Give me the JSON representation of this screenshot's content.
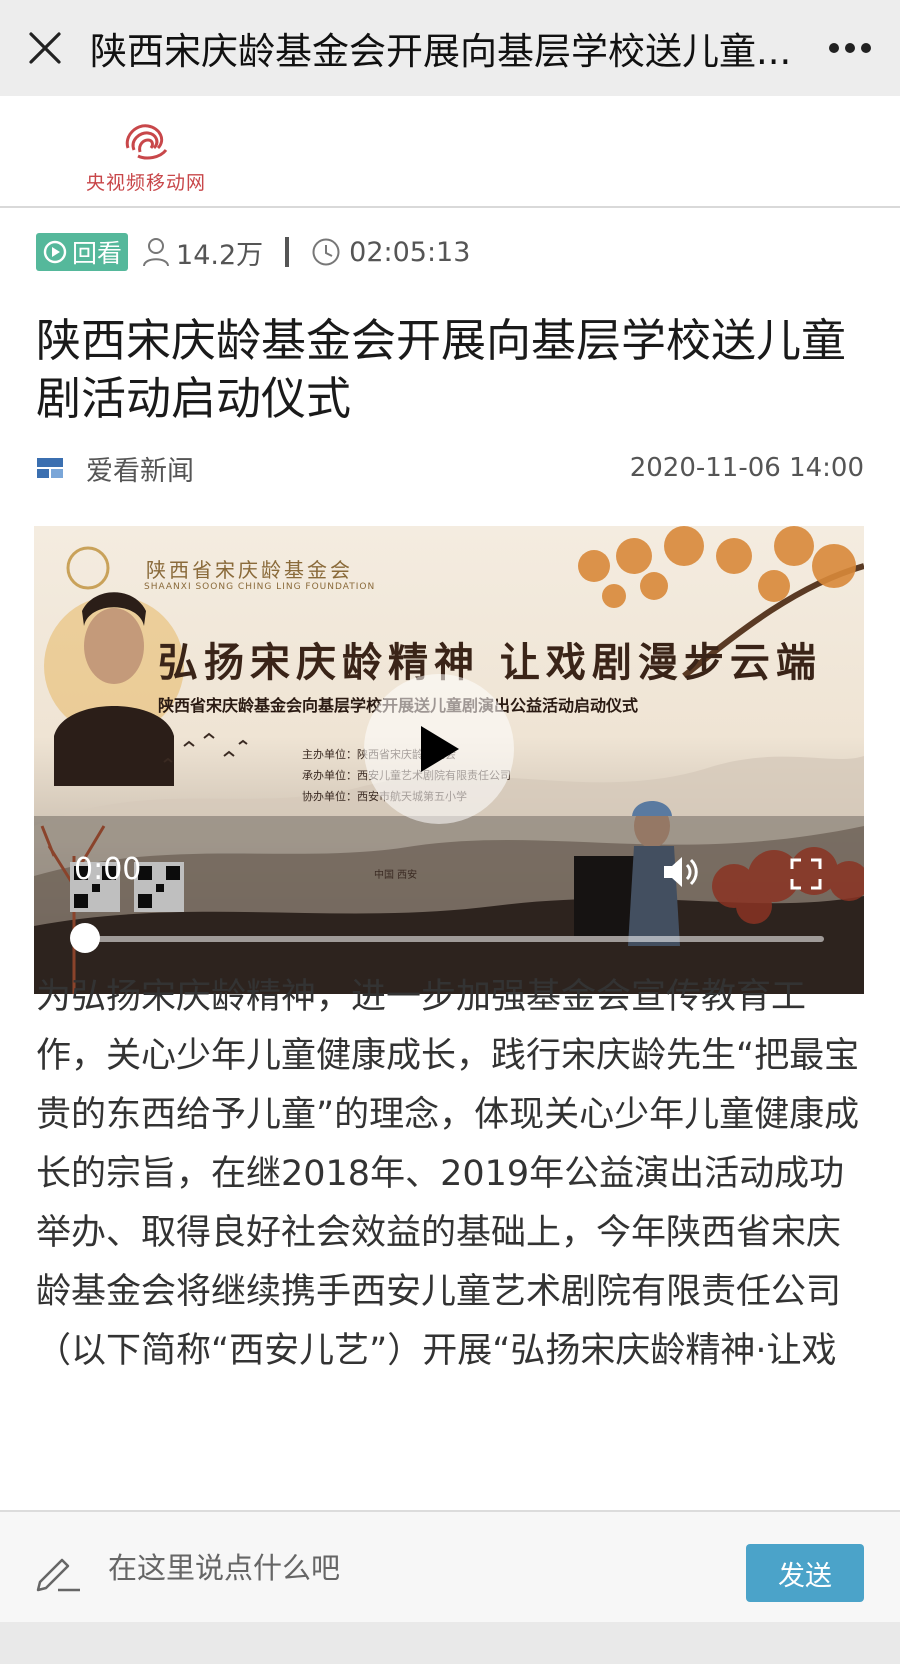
{
  "topbar": {
    "title": "陕西宋庆龄基金会开展向基层学校送儿童...",
    "close_icon": "close-icon",
    "more_icon": "more-icon"
  },
  "site": {
    "logo_text": "央视频移动网"
  },
  "meta": {
    "replay_label": "回看",
    "views": "14.2万",
    "duration": "02:05:13",
    "colors": {
      "replay_badge": "#55b89b",
      "meta_text": "#555555"
    }
  },
  "article": {
    "title": "陕西宋庆龄基金会开展向基层学校送儿童剧活动启动仪式",
    "source": "爱看新闻",
    "date": "2020-11-06 14:00",
    "body": "为弘扬宋庆龄精神，进一步加强基金会宣传教育工作，关心少年儿童健康成长，践行宋庆龄先生“把最宝贵的东西给予儿童”的理念，体现关心少年儿童健康成长的宗旨，在继2018年、2019年公益演出活动成功举办、取得良好社会效益的基础上，今年陕西省宋庆龄基金会将继续携手西安儿童艺术剧院有限责任公司（以下简称“西安儿艺”）开展“弘扬宋庆龄精神·让戏"
  },
  "video": {
    "org_name": "陕西省宋庆龄基金会",
    "org_sub": "SHAANXI SOONG CHING LING FOUNDATION",
    "headline": "弘扬宋庆龄精神  让戏剧漫步云端",
    "subhead": "陕西省宋庆龄基金会向基层学校开展送儿童剧演出公益活动启动仪式",
    "credits": [
      "主办单位：陕西省宋庆龄基金会",
      "承办单位：西安儿童艺术剧院有限责任公司",
      "协办单位：西安市航天城第五小学"
    ],
    "location": "中国  西安",
    "current_time": "0:00",
    "progress": 0.0
  },
  "comment": {
    "placeholder": "在这里说点什么吧",
    "send_label": "发送",
    "send_color": "#4ba3c9"
  }
}
